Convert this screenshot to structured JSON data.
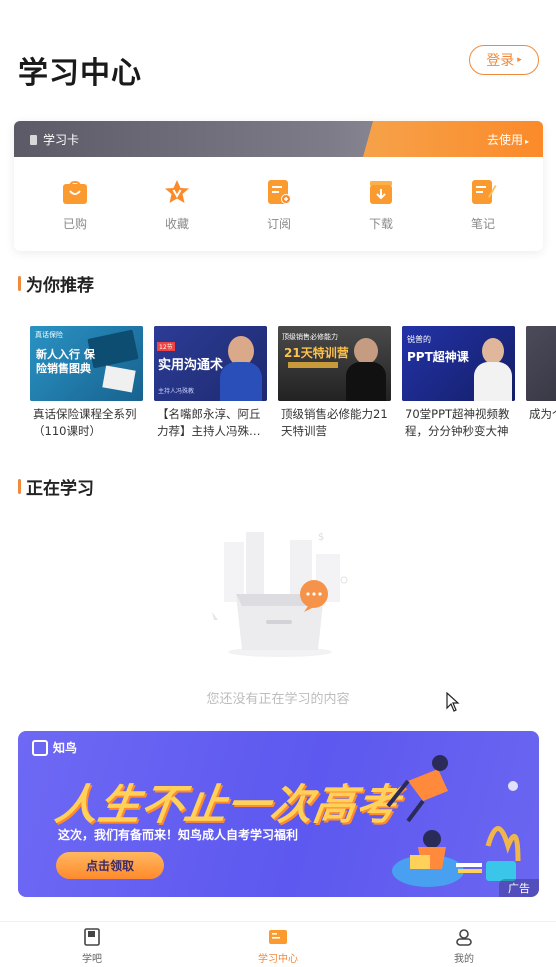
{
  "header": {
    "title": "学习中心",
    "login_label": "登录"
  },
  "study_card": {
    "label": "学习卡",
    "use_label": "去使用",
    "items": [
      {
        "label": "已购",
        "icon": "shopping-bag-icon"
      },
      {
        "label": "收藏",
        "icon": "star-icon"
      },
      {
        "label": "订阅",
        "icon": "subscribe-icon"
      },
      {
        "label": "下载",
        "icon": "download-icon"
      },
      {
        "label": "笔记",
        "icon": "note-icon"
      }
    ]
  },
  "recommend": {
    "title": "为你推荐",
    "courses": [
      {
        "title": "真话保险课程全系列（110课时）",
        "thumb_text": "新人入行 保险销售图典",
        "thumb_logo": "真话保险"
      },
      {
        "title": "【名嘴郎永淳、阿丘力荐】主持人冯殊…",
        "thumb_text": "实用沟通术",
        "thumb_badge": "12节",
        "thumb_sub": "主持人冯殊教"
      },
      {
        "title": "顶级销售必修能力21天特训营",
        "thumb_text": "21天特训营",
        "thumb_sub": "顶级销售必修能力"
      },
      {
        "title": "70堂PPT超神视频教程，分分钟秒变大神",
        "thumb_text": "PPT超神课",
        "thumb_sub": "锐普的"
      },
      {
        "title": "成为个",
        "thumb_text": ""
      }
    ]
  },
  "learning": {
    "title": "正在学习",
    "empty_text": "您还没有正在学习的内容"
  },
  "ad": {
    "brand": "知鸟",
    "headline": "人生不止一次高考",
    "subtitle": "这次，我们有备而来！知鸟成人自考学习福利",
    "cta": "点击领取",
    "tag": "广告"
  },
  "tabbar": {
    "items": [
      {
        "label": "学吧",
        "icon": "book-icon"
      },
      {
        "label": "学习中心",
        "icon": "study-center-icon",
        "active": true
      },
      {
        "label": "我的",
        "icon": "profile-icon"
      }
    ]
  },
  "colors": {
    "accent": "#f08a3c",
    "ad_bg": "#6560f2"
  }
}
